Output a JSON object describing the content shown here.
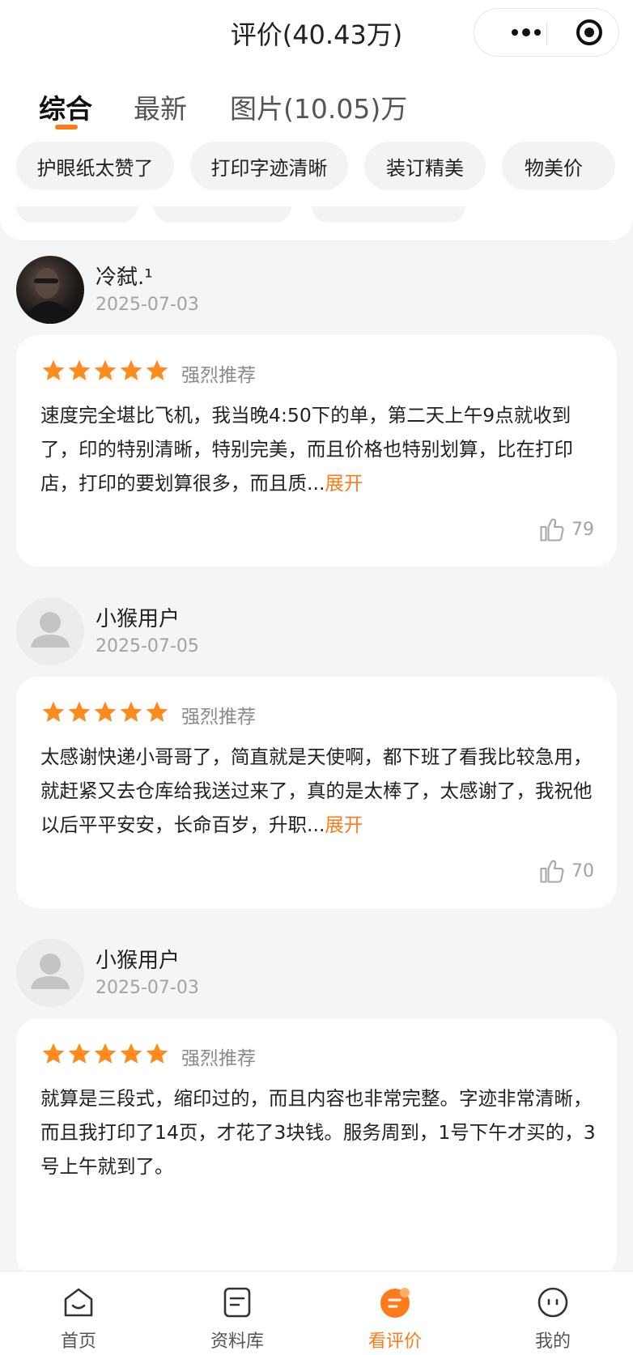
{
  "header": {
    "title": "评价(40.43万)",
    "more_icon": "more-dots-icon",
    "close_icon": "target-icon"
  },
  "tabs": [
    {
      "label": "综合",
      "active": true
    },
    {
      "label": "最新",
      "active": false
    },
    {
      "label": "图片(10.05)万",
      "active": false
    }
  ],
  "chips": [
    "护眼纸太赞了",
    "打印字迹清晰",
    "装订精美",
    "物美价"
  ],
  "reviews": [
    {
      "name": "冷弑.¹",
      "date": "2025-07-03",
      "avatar": "photo",
      "stars": 5,
      "rating_label": "强烈推荐",
      "text": "速度完全堪比飞机，我当晚4:50下的单，第二天上午9点就收到了，印的特别清晰，特别完美，而且价格也特别划算，比在打印店，打印的要划算很多，而且质...",
      "expand": "展开",
      "likes": "79"
    },
    {
      "name": "小猴用户",
      "date": "2025-07-05",
      "avatar": "default",
      "stars": 5,
      "rating_label": "强烈推荐",
      "text": "太感谢快递小哥哥了，简直就是天使啊，都下班了看我比较急用，就赶紧又去仓库给我送过来了，真的是太棒了，太感谢了，我祝他以后平平安安，长命百岁，升职...",
      "expand": "展开",
      "likes": "70"
    },
    {
      "name": "小猴用户",
      "date": "2025-07-03",
      "avatar": "default",
      "stars": 5,
      "rating_label": "强烈推荐",
      "text": "就算是三段式，缩印过的，而且内容也非常完整。字迹非常清晰，而且我打印了14页，才花了3块钱。服务周到，1号下午才买的，3号上午就到了。",
      "expand": "",
      "likes": ""
    }
  ],
  "bottom_nav": [
    {
      "label": "首页",
      "icon": "home-smile-icon",
      "active": false
    },
    {
      "label": "资料库",
      "icon": "document-icon",
      "active": false
    },
    {
      "label": "看评价",
      "icon": "review-chat-icon",
      "active": true
    },
    {
      "label": "我的",
      "icon": "profile-face-icon",
      "active": false
    }
  ],
  "colors": {
    "accent": "#ff7a1a",
    "star": "#ff8a1f"
  }
}
